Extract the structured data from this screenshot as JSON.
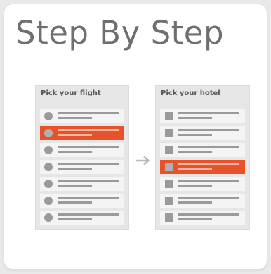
{
  "card": {
    "title": "Step By Step"
  },
  "flight_panel": {
    "label": "Pick your flight",
    "row_count": 7,
    "selected_row": 2
  },
  "hotel_panel": {
    "label": "Pick your hotel",
    "row_count": 7,
    "selected_row": 4
  },
  "arrow": {
    "icon": "arrow-right-icon"
  },
  "colors": {
    "accent": "#e8522a",
    "title": "#6f6f6f",
    "panel_bg": "#e6e6e6",
    "row_bg": "#f4f4f4",
    "placeholder": "#9a9a9a"
  }
}
